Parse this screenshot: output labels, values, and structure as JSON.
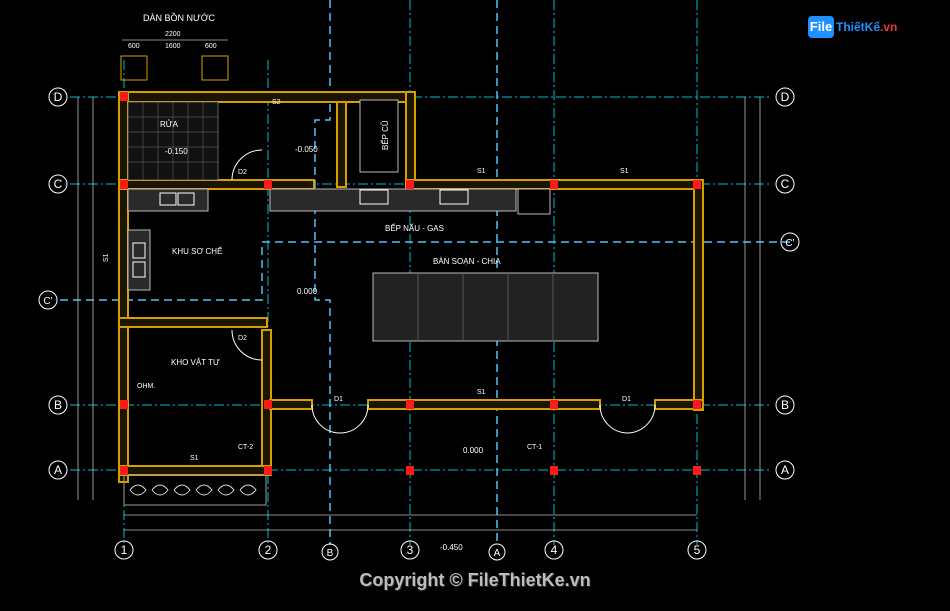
{
  "watermark": {
    "brand_badge": "File",
    "brand_text": "ThiếtKế",
    "brand_suffix": ".vn",
    "copyright": "Copyright © FileThietKe.vn"
  },
  "tank": {
    "label": "DÀN BỒN NƯỚC",
    "dims": [
      "2200",
      "600",
      "1600",
      "600"
    ]
  },
  "axes": {
    "rows": [
      "D",
      "C",
      "C'",
      "B",
      "A"
    ],
    "cols": [
      "1",
      "2",
      "3",
      "4",
      "5"
    ],
    "section_marks": [
      "B",
      "A"
    ]
  },
  "rooms": {
    "wash": "RỬA",
    "old_kitchen": "BẾP CŨ",
    "cooking": "BẾP NẤU - GAS",
    "prep": "KHU SƠ CHẾ",
    "serving": "BÀN SOẠN - CHIA",
    "storage": "KHO VẬT TƯ",
    "ohm": "OHM."
  },
  "levels": {
    "wash": "-0.150",
    "old_kitchen": "-0.050",
    "prep": "0.000",
    "hall": "0.000",
    "outside": "-0.450"
  },
  "doors": [
    "D2",
    "D2",
    "D1",
    "D1"
  ],
  "windows": [
    "S1",
    "S1",
    "S1",
    "S1",
    "S1",
    "S2"
  ],
  "columns_tags": [
    "CT-2",
    "CT-1"
  ],
  "colors": {
    "wall": "#d4a000",
    "grid": "#00bcd4",
    "column": "#ff1a1a",
    "text": "#ffffff",
    "dim": "#00e676"
  }
}
